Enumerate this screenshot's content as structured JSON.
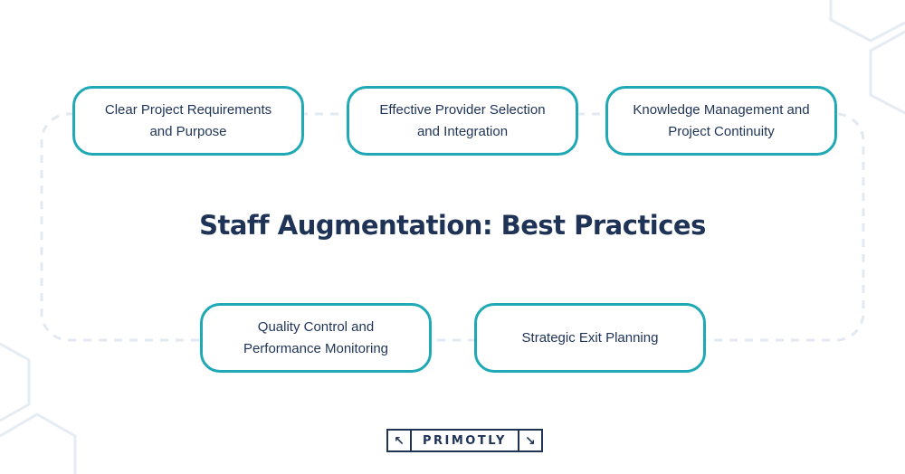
{
  "title": "Staff Augmentation: Best Practices",
  "practices": [
    {
      "line1": "Clear Project Requirements",
      "line2": "and Purpose"
    },
    {
      "line1": "Effective Provider Selection",
      "line2": "and Integration"
    },
    {
      "line1": "Knowledge Management and",
      "line2": "Project Continuity"
    },
    {
      "line1": "Quality Control and",
      "line2": "Performance Monitoring"
    },
    {
      "line1": "Strategic Exit Planning",
      "line2": ""
    }
  ],
  "logo": {
    "text": "PRIMOTLY",
    "left_icon": "arrow-up-left-icon",
    "right_icon": "arrow-down-right-icon",
    "left_glyph": "↖",
    "right_glyph": "↘"
  },
  "colors": {
    "card_border": "#1fa9b5",
    "text": "#1e3356",
    "connector": "#e3e9f1",
    "hexagon": "#e6ecf3"
  }
}
